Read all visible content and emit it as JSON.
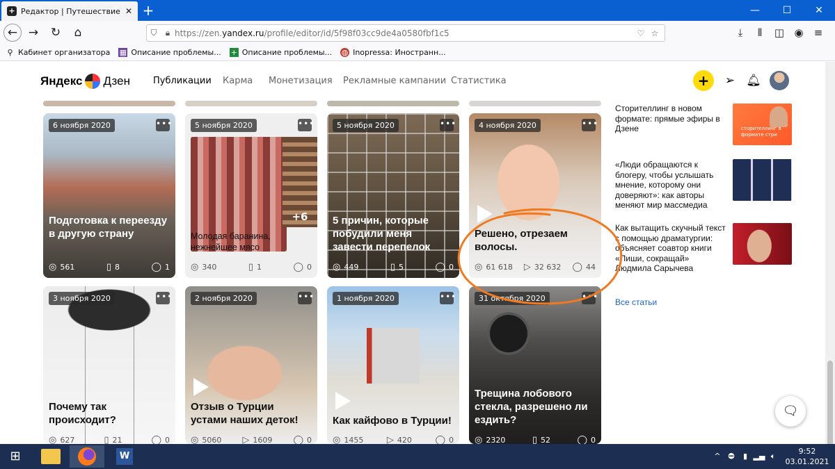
{
  "browser": {
    "tab_title": "Редактор | Путешествие по ж",
    "url_prefix": "https://zen.",
    "url_domain": "yandex.ru",
    "url_path": "/profile/editor/id/5f98f03cc9de4a0580fbf1c5",
    "bookmarks": [
      {
        "label": "Кабинет организатора",
        "icon": "person-icon",
        "color": "#333333"
      },
      {
        "label": "Описание проблемы...",
        "icon": "grid-icon",
        "color": "#6b3fa0"
      },
      {
        "label": "Описание проблемы...",
        "icon": "plus-square-icon",
        "color": "#1f8a3a"
      },
      {
        "label": "Inopressa: Иностранн...",
        "icon": "globe-icon",
        "color": "#c0392b"
      }
    ]
  },
  "zen": {
    "logo_yandex": "Яндекс",
    "logo_dzen": "Дзен",
    "menu": [
      "Публикации",
      "Карма",
      "Монетизация",
      "Рекламные кампании",
      "Статистика"
    ],
    "plus_label": "+"
  },
  "cards": [
    {
      "date": "6 ноября 2020",
      "title": "Подготовка к переезду в другую страну",
      "views": "561",
      "second": "8",
      "comments": "1"
    },
    {
      "date": "5 ноября 2020",
      "title": "Молодая баранина, нежнейшее мясо",
      "views": "340",
      "second": "1",
      "comments": "0",
      "extra": "+6"
    },
    {
      "date": "5 ноября 2020",
      "title": "5 причин, которые побудили меня завести перепелок",
      "views": "449",
      "second": "5",
      "comments": "0"
    },
    {
      "date": "4 ноября 2020",
      "title": "Решено, отрезаем волосы.",
      "views": "61 618",
      "second": "32 632",
      "comments": "44"
    },
    {
      "date": "3 ноября 2020",
      "title": "Почему так происходит?",
      "views": "627",
      "second": "21",
      "comments": "0"
    },
    {
      "date": "2 ноября 2020",
      "title": "Отзыв о Турции устами наших деток!",
      "views": "5060",
      "second": "1609",
      "comments": "0"
    },
    {
      "date": "1 ноября 2020",
      "title": "Как кайфово в Турции!",
      "views": "1455",
      "second": "420",
      "comments": "0"
    },
    {
      "date": "31 октября 2020",
      "title": "Трещина лобового стекла, разрешено ли ездить?",
      "views": "2320",
      "second": "52",
      "comments": "0"
    }
  ],
  "more_label": "•••",
  "sidebar": {
    "articles": [
      "Сторителлинг в новом формате: прямые эфиры в Дзене",
      "«Люди обращаются к блогеру, чтобы услышать мнение, которому они доверяют»: как авторы меняют мир массмедиа",
      "Как вытащить скучный текст с помощью драматургии: объясняет соавтор книги «Пиши, сокращай» Людмила Сарычева"
    ],
    "thumb_caption": "сторителлинг в формате стри",
    "all_articles": "Все статьи"
  },
  "taskbar": {
    "time": "9:52",
    "date": "03.01.2021"
  },
  "colors": {
    "browser_blue": "#0a5fd1",
    "zen_yellow": "#ffdb0d",
    "link_blue": "#1a63d6",
    "annotation_orange": "#f07a22",
    "taskbar": "#1c2f52"
  }
}
